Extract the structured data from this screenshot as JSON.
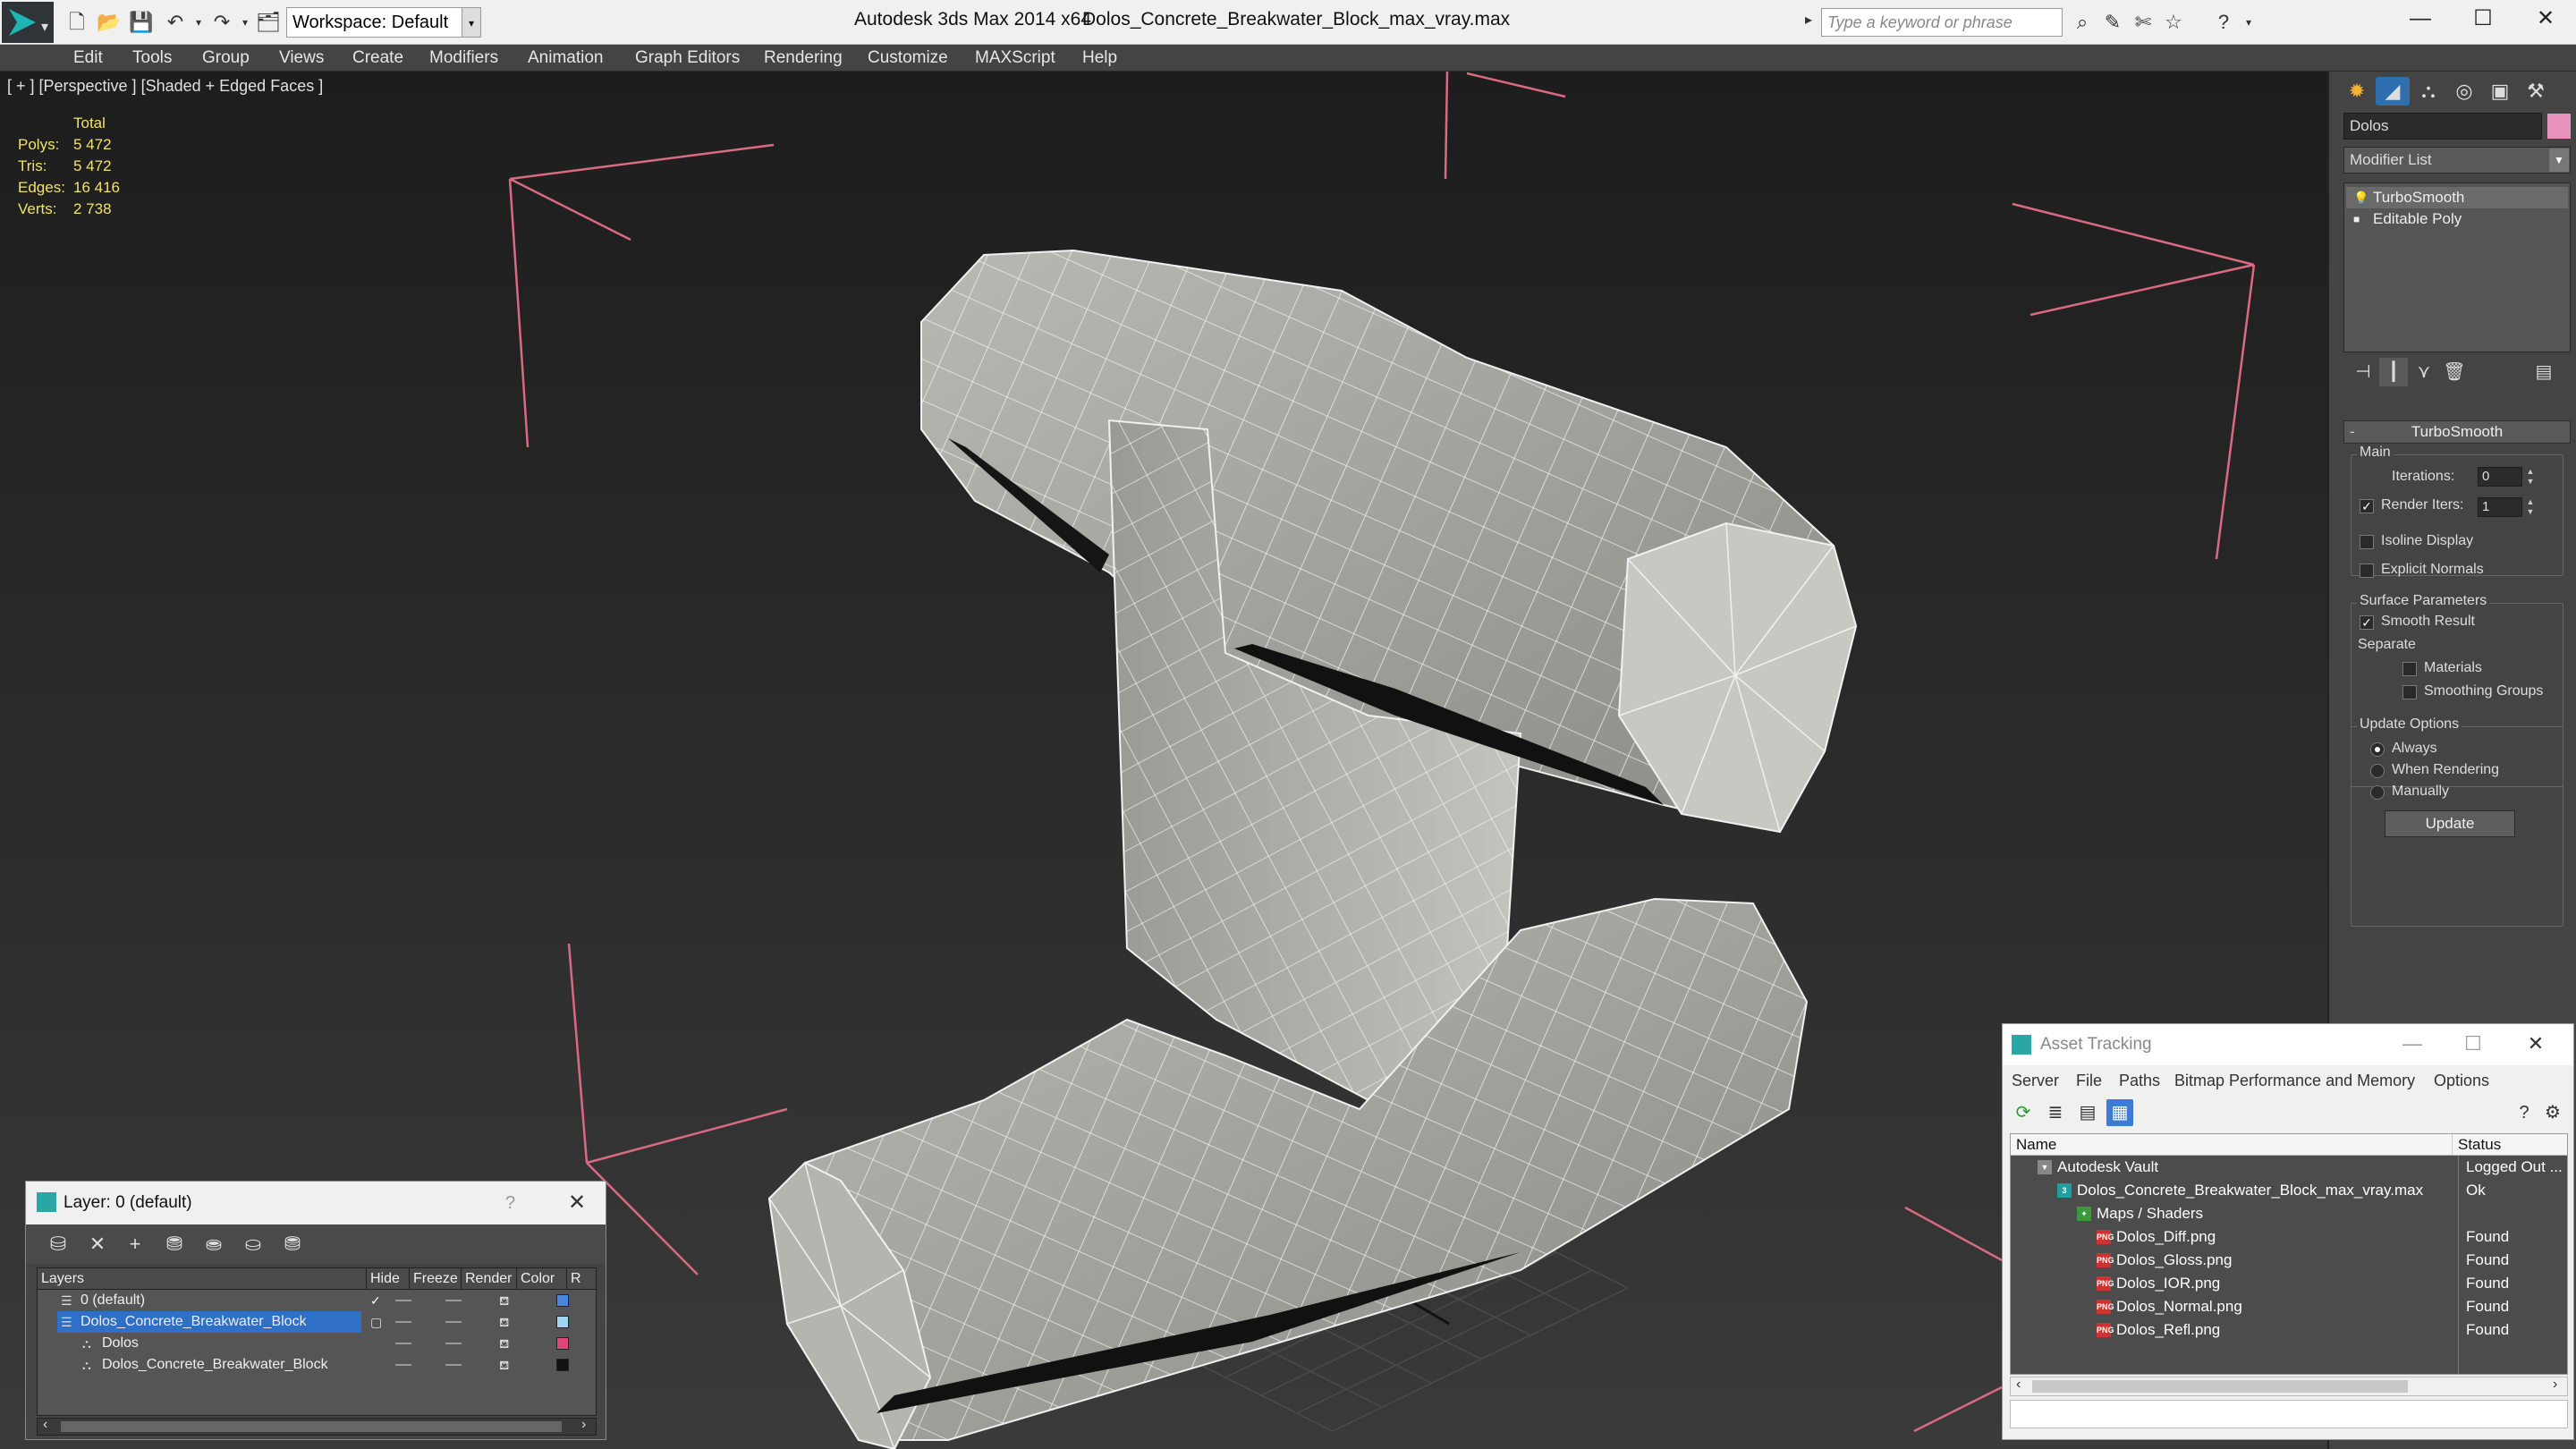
{
  "app": {
    "title": "Autodesk 3ds Max  2014 x64",
    "file": "Dolos_Concrete_Breakwater_Block_max_vray.max",
    "workspace": "Workspace: Default",
    "search_placeholder": "Type a keyword or phrase"
  },
  "menu": [
    "Edit",
    "Tools",
    "Group",
    "Views",
    "Create",
    "Modifiers",
    "Animation",
    "Graph Editors",
    "Rendering",
    "Customize",
    "MAXScript",
    "Help"
  ],
  "viewport": {
    "label": "[ + ] [Perspective ] [Shaded + Edged Faces ]",
    "stats": {
      "total_label": "Total",
      "rows": [
        {
          "label": "Polys:",
          "value": "5 472"
        },
        {
          "label": "Tris:",
          "value": "5 472"
        },
        {
          "label": "Edges:",
          "value": "16 416"
        },
        {
          "label": "Verts:",
          "value": "2 738"
        }
      ]
    }
  },
  "command_panel": {
    "object_name": "Dolos",
    "object_color": "#e893bd",
    "modifier_list": "Modifier List",
    "stack": [
      {
        "name": "TurboSmooth",
        "icon": "lightbulb-icon"
      },
      {
        "name": "Editable Poly",
        "icon": "square-icon"
      }
    ],
    "turbosmooth": {
      "title": "TurboSmooth",
      "main_label": "Main",
      "iterations_label": "Iterations:",
      "iterations_value": "0",
      "render_iters_label": "Render Iters:",
      "render_iters_value": "1",
      "render_iters_checked": true,
      "isoline_label": "Isoline Display",
      "explicit_normals_label": "Explicit Normals",
      "surface_params_label": "Surface Parameters",
      "smooth_result_label": "Smooth Result",
      "smooth_result_checked": true,
      "separate_label": "Separate",
      "materials_label": "Materials",
      "smoothing_groups_label": "Smoothing Groups",
      "update_options_label": "Update Options",
      "always_label": "Always",
      "when_rendering_label": "When Rendering",
      "manually_label": "Manually",
      "selected_update": "Always",
      "update_button": "Update"
    }
  },
  "layer_dialog": {
    "title": "Layer: 0 (default)",
    "help": "?",
    "columns": [
      "Layers",
      "Hide",
      "Freeze",
      "Render",
      "Color",
      "R"
    ],
    "rows": [
      {
        "name": "0 (default)",
        "color": "#4a86e0",
        "active": true,
        "selected": false,
        "indent": 1
      },
      {
        "name": "Dolos_Concrete_Breakwater_Block",
        "color": "#9fd5f0",
        "active": false,
        "selected": true,
        "indent": 1
      },
      {
        "name": "Dolos",
        "color": "#e0457a",
        "active": false,
        "selected": false,
        "indent": 2
      },
      {
        "name": "Dolos_Concrete_Breakwater_Block",
        "color": "#111111",
        "active": false,
        "selected": false,
        "indent": 2
      }
    ]
  },
  "asset_tracking": {
    "title": "Asset Tracking",
    "menu": [
      "Server",
      "File",
      "Paths",
      "Bitmap Performance and Memory",
      "Options"
    ],
    "columns": [
      "Name",
      "Status"
    ],
    "rows": [
      {
        "name": "Autodesk Vault",
        "status": "Logged Out ...",
        "indent": 1,
        "icon": "vault-icon"
      },
      {
        "name": "Dolos_Concrete_Breakwater_Block_max_vray.max",
        "status": "Ok",
        "indent": 2,
        "icon": "max-file-icon"
      },
      {
        "name": "Maps / Shaders",
        "status": "",
        "indent": 3,
        "icon": "maps-icon"
      },
      {
        "name": "Dolos_Diff.png",
        "status": "Found",
        "indent": 4,
        "icon": "png-icon"
      },
      {
        "name": "Dolos_Gloss.png",
        "status": "Found",
        "indent": 4,
        "icon": "png-icon"
      },
      {
        "name": "Dolos_IOR.png",
        "status": "Found",
        "indent": 4,
        "icon": "png-icon"
      },
      {
        "name": "Dolos_Normal.png",
        "status": "Found",
        "indent": 4,
        "icon": "png-icon"
      },
      {
        "name": "Dolos_Refl.png",
        "status": "Found",
        "indent": 4,
        "icon": "png-icon"
      }
    ]
  }
}
